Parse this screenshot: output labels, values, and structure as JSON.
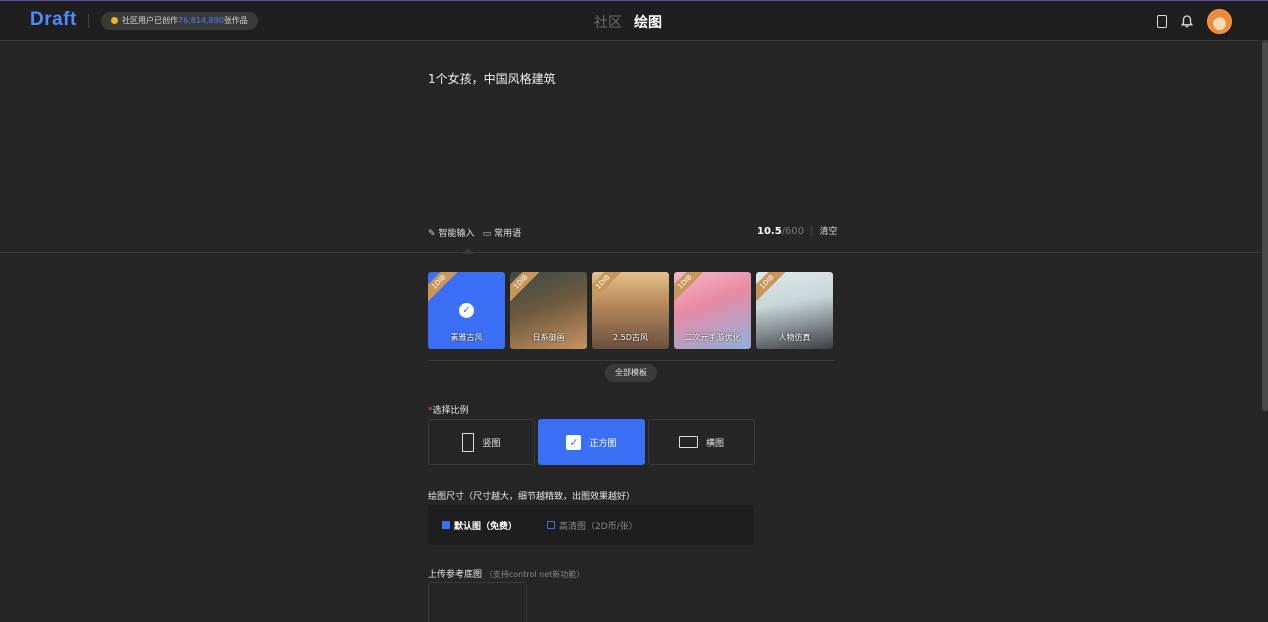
{
  "header": {
    "logo": "Draft",
    "stats": {
      "prefix": "社区用户已创作",
      "count": "76,814,890",
      "suffix": "张作品"
    },
    "nav": [
      "社区",
      "绘图"
    ],
    "active_nav": "绘图"
  },
  "prompt": {
    "text": "1个女孩，中国风格建筑",
    "tools": [
      "智能输入",
      "常用语"
    ],
    "count_current": "10.5",
    "count_max": "/600",
    "clear_label": "清空"
  },
  "templates": {
    "tag": "1DIB",
    "items": [
      {
        "name": "素雅古风",
        "selected": true
      },
      {
        "name": "日系御画"
      },
      {
        "name": "2.5D古风"
      },
      {
        "name": "二次元手游优化"
      },
      {
        "name": "人物仿真"
      }
    ],
    "all_label": "全部模板"
  },
  "ratio": {
    "label": "选择比例",
    "required_mark": "*",
    "options": [
      "竖图",
      "正方图",
      "横图"
    ],
    "selected": "正方图"
  },
  "size": {
    "label": "绘图尺寸（尺寸越大，细节越精致，出图效果越好）",
    "options": [
      "默认图（免费）",
      "高清图（2D币/张）"
    ],
    "selected": "默认图（免费）"
  },
  "upload": {
    "label": "上传参考底图",
    "hint": "（支持control net新功能）"
  },
  "colors": {
    "accent": "#3b6ff5",
    "logo": "#4f8cff",
    "tag": "#c9965a"
  }
}
